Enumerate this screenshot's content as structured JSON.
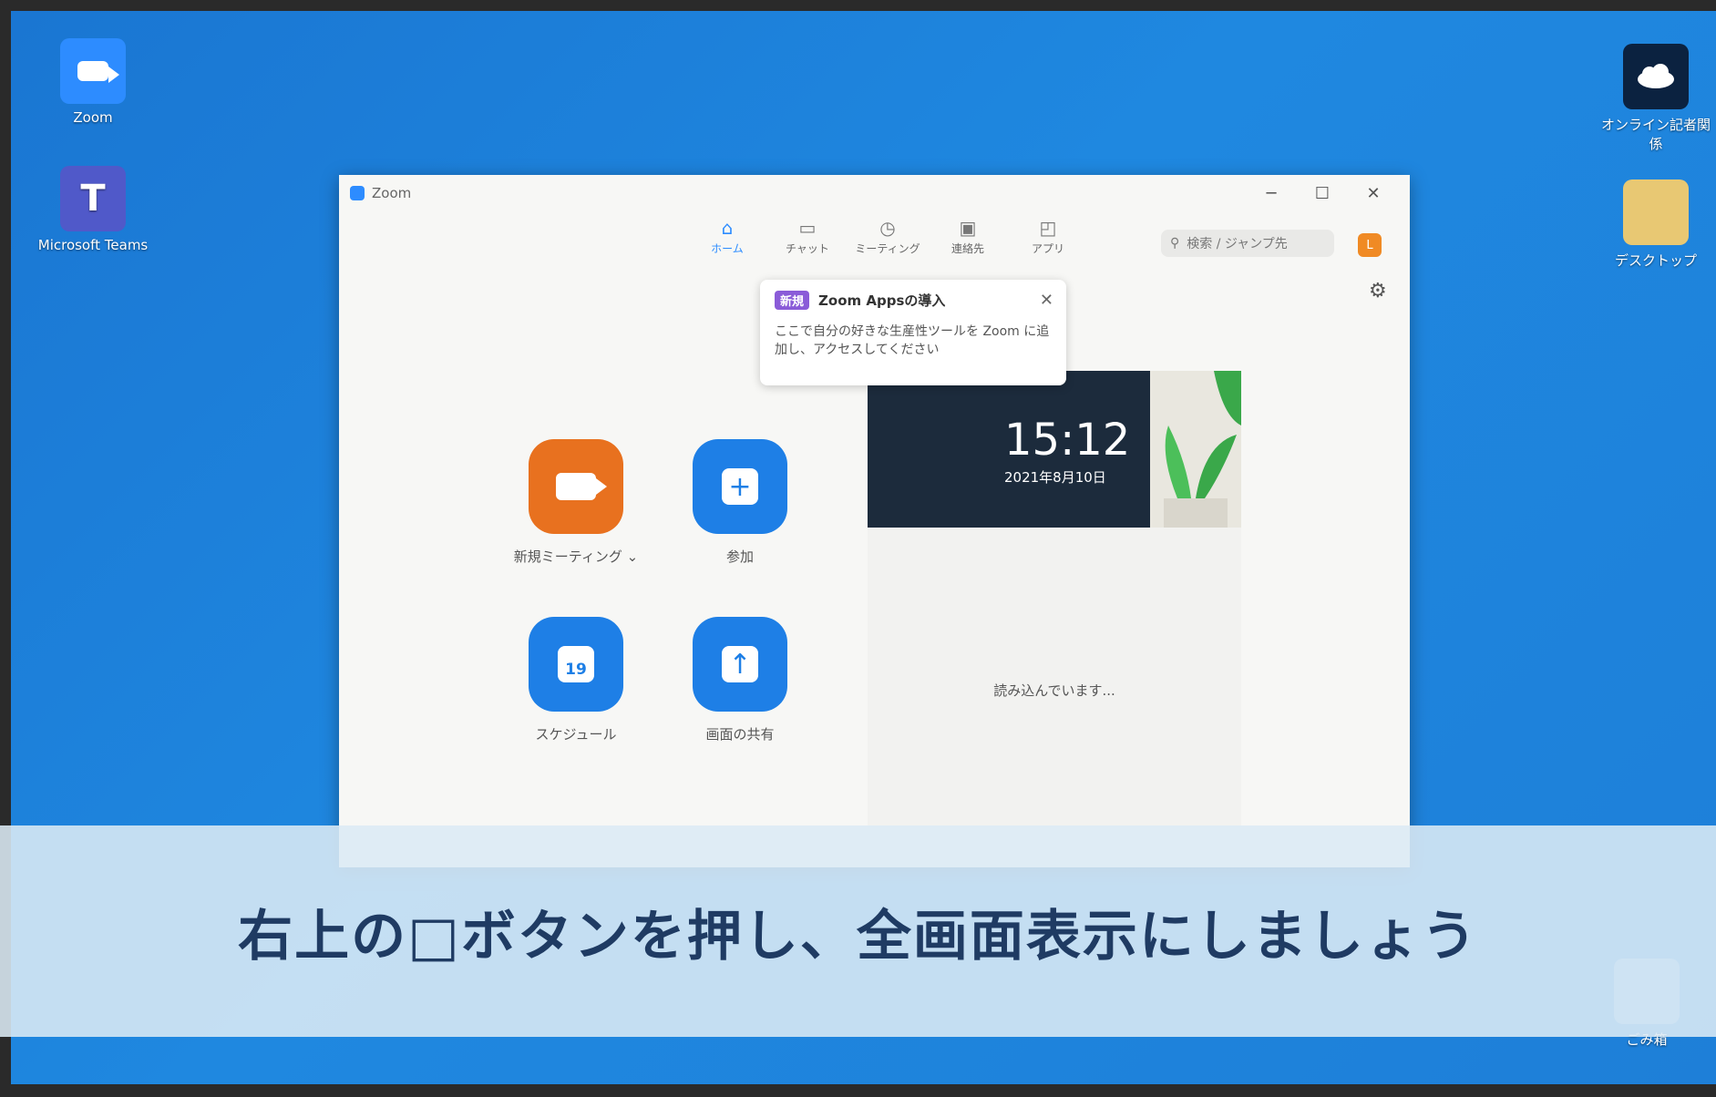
{
  "desktop": {
    "icons": [
      {
        "label": "Zoom"
      },
      {
        "label": "Microsoft Teams"
      },
      {
        "label": "オンライン記者関係"
      },
      {
        "label": "デスクトップ"
      },
      {
        "label": "ごみ箱"
      }
    ]
  },
  "window": {
    "title": "Zoom",
    "controls": {
      "minimize": "─",
      "maximize": "☐",
      "close": "✕"
    },
    "nav": [
      {
        "label": "ホーム",
        "icon": "home-icon",
        "glyph": "⌂",
        "active": true
      },
      {
        "label": "チャット",
        "icon": "chat-icon",
        "glyph": "▭"
      },
      {
        "label": "ミーティング",
        "icon": "clock-icon",
        "glyph": "◷"
      },
      {
        "label": "連絡先",
        "icon": "contacts-icon",
        "glyph": "▣"
      },
      {
        "label": "アプリ",
        "icon": "apps-icon",
        "glyph": "◰"
      }
    ],
    "search_placeholder": "検索 / ジャンプ先",
    "avatar_initial": "L",
    "settings_icon": "gear-icon",
    "tooltip": {
      "badge": "新規",
      "title": "Zoom Appsの導入",
      "close": "✕",
      "body": "ここで自分の好きな生産性ツールを Zoom に追加し、アクセスしてください"
    },
    "actions": {
      "new_meeting": "新規ミーティング",
      "new_meeting_chevron": "⌄",
      "join": "参加",
      "join_glyph": "+",
      "schedule": "スケジュール",
      "schedule_day": "19",
      "share": "画面の共有",
      "share_glyph": "↑"
    },
    "clock": {
      "time": "15:12",
      "date": "2021年8月10日"
    },
    "loading": "読み込んでいます..."
  },
  "caption": "右上の□ボタンを押し、全画面表示にしましょう",
  "colors": {
    "desktop": "#1f88e0",
    "zoom_blue": "#1e7fe6",
    "zoom_orange": "#e8711f",
    "caption_text": "#1f3b63"
  }
}
